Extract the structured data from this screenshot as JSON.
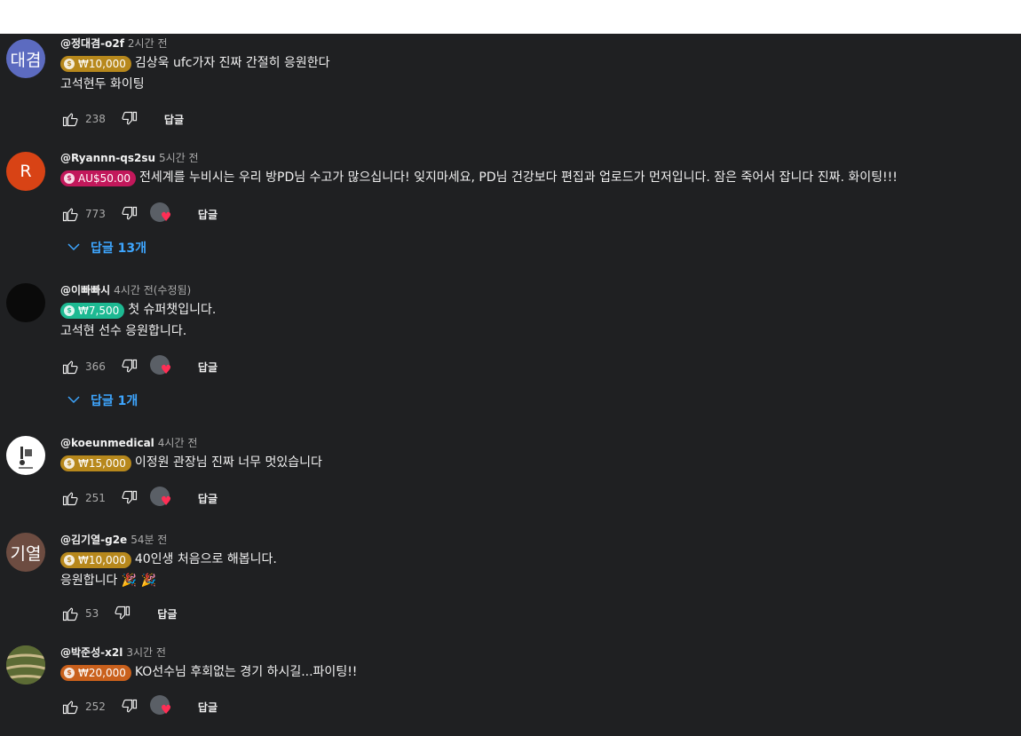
{
  "comments": [
    {
      "author": "@정대겸-o2f",
      "time": "2시간 전",
      "avatar_text": "대겸",
      "avatar_color": "#5c6bc0",
      "chip": {
        "amount": "₩10,000",
        "color": "#b7881c"
      },
      "lines": [
        "김상욱 ufc가자 진짜 간절히 응원한다",
        "고석현두 화이팅"
      ],
      "likes": "238",
      "reply_label": "답글"
    },
    {
      "author": "@Ryannn-qs2su",
      "time": "5시간 전",
      "avatar_text": "R",
      "avatar_color": "#e64a19",
      "chip": {
        "amount": "AU$50.00",
        "color": "#c2185b"
      },
      "lines": [
        "전세계를 누비시는 우리 방PD님 수고가 많으십니다! 잊지마세요, PD님 건강보다 편집과 업로드가 먼저입니다. 잠은 죽어서 잡니다 진짜. 화이팅!!!"
      ],
      "likes": "773",
      "reply_label": "답글",
      "replies_label": "답글 13개"
    },
    {
      "author": "@이빠빠시",
      "time": "4시간 전(수정됨)",
      "avatar_text": "",
      "avatar_color": "#0a0a0a",
      "chip": {
        "amount": "₩7,500",
        "color": "#1db992"
      },
      "lines": [
        "첫 슈퍼챗입니다.",
        "고석현 선수 응원합니다."
      ],
      "likes": "366",
      "reply_label": "답글",
      "replies_label": "답글 1개"
    },
    {
      "author": "@koeunmedical",
      "time": "4시간 전",
      "avatar_text": "",
      "avatar_color": "#ffffff",
      "chip": {
        "amount": "₩15,000",
        "color": "#b7881c"
      },
      "lines": [
        "이정원 관장님 진짜 너무 멋있습니다"
      ],
      "likes": "251",
      "reply_label": "답글"
    },
    {
      "author": "@김기열-g2e",
      "time": "54분 전",
      "avatar_text": "기열",
      "avatar_color": "#6d4c41",
      "chip": {
        "amount": "₩10,000",
        "color": "#b7881c"
      },
      "lines": [
        "40인생 처음으로 해봅니다.",
        "응원합니다 🎉 🎉"
      ],
      "likes": "53",
      "reply_label": "답글"
    },
    {
      "author": "@박준성-x2l",
      "time": "3시간 전",
      "avatar_text": "",
      "avatar_color": "#6b7a3c",
      "chip": {
        "amount": "₩20,000",
        "color": "#c9601c"
      },
      "lines": [
        "KO선수님 후회없는 경기 하시길...파이팅!!"
      ],
      "likes": "252",
      "reply_label": "답글"
    }
  ]
}
